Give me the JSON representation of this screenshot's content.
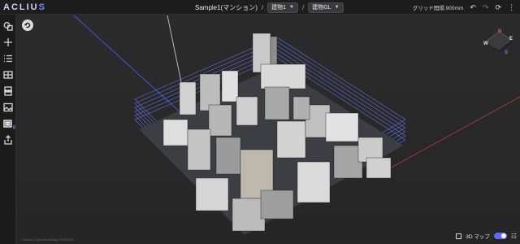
{
  "app": {
    "logo_main": "ACLIU",
    "logo_accent": "S"
  },
  "header": {
    "project_title": "Sample1(マンション)",
    "separator": "/",
    "building_select": "建物1",
    "level_select": "建物GL",
    "grid_label": "グリッド間隔 900mm"
  },
  "viewport": {
    "map_toggle_label": "3D マップ",
    "map_toggle_on": true,
    "copyright": "Cesium, OpenStreetMap, PLATEAU"
  },
  "compass": {
    "n": "N",
    "e": "E",
    "s": "S",
    "w": "W"
  },
  "colors": {
    "accent": "#5b6cf0",
    "background": "#2a2a2b",
    "grid_box": "#6f7cff"
  }
}
